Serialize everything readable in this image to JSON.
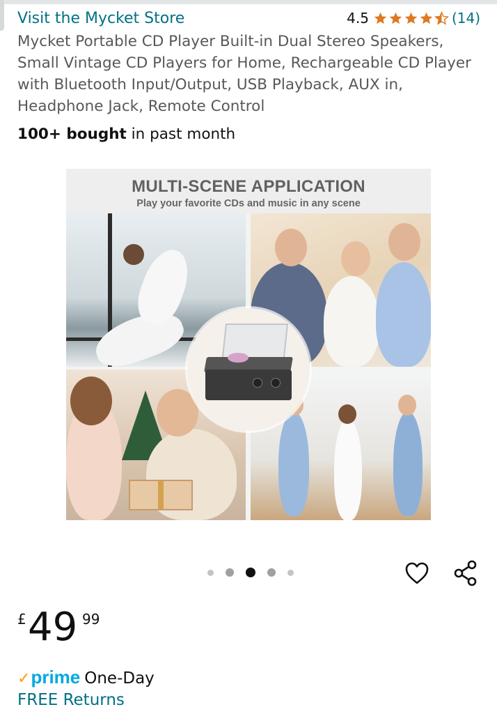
{
  "store": {
    "link_label": "Visit the Mycket Store"
  },
  "rating": {
    "score": "4.5",
    "stars_value": 4.5,
    "count": "(14)"
  },
  "product": {
    "title": "Mycket Portable CD Player Built-in Dual Stereo Speakers, Small Vintage CD Players for Home, Rechargeable CD Player with Bluetooth Input/Output, USB Playback, AUX in, Headphone Jack, Remote Control",
    "bought_bold": "100+ bought",
    "bought_rest": " in past month"
  },
  "image": {
    "headline": "MULTI-SCENE APPLICATION",
    "subheadline": "Play your favorite CDs and music in any scene",
    "carousel": {
      "total": 5,
      "active_index": 2
    }
  },
  "price": {
    "currency": "£",
    "whole": "49",
    "fraction": "99"
  },
  "delivery": {
    "prime_check": "✓",
    "prime_word": "prime",
    "speed": "One-Day",
    "returns": "FREE Returns"
  },
  "colors": {
    "link": "#007185",
    "star": "#de7921",
    "prime_blue": "#00a8e1",
    "prime_check": "#ff9900"
  },
  "icons": {
    "wishlist": "heart-icon",
    "share": "share-icon"
  }
}
